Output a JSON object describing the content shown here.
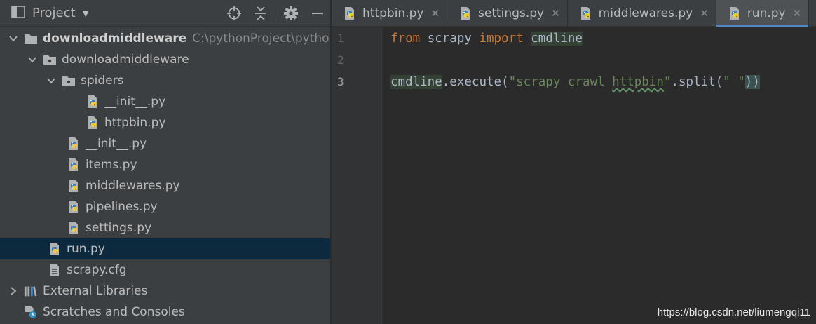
{
  "project_panel": {
    "title": "Project",
    "tools": [
      "target-icon",
      "collapse-icon",
      "gear-icon",
      "minimize-icon"
    ]
  },
  "tree": [
    {
      "label": "downloadmiddleware",
      "path": "C:\\pythonProject\\pytho",
      "icon": "folder-icon",
      "bold": true,
      "expanded": true,
      "depth": 0
    },
    {
      "label": "downloadmiddleware",
      "icon": "package-icon",
      "expanded": true,
      "depth": 1
    },
    {
      "label": "spiders",
      "icon": "package-icon",
      "expanded": true,
      "depth": 2
    },
    {
      "label": "__init__.py",
      "icon": "python-file-icon",
      "depth": 3
    },
    {
      "label": "httpbin.py",
      "icon": "python-file-icon",
      "depth": 3
    },
    {
      "label": "__init__.py",
      "icon": "python-file-icon",
      "depth": 2
    },
    {
      "label": "items.py",
      "icon": "python-file-icon",
      "depth": 2
    },
    {
      "label": "middlewares.py",
      "icon": "python-file-icon",
      "depth": 2
    },
    {
      "label": "pipelines.py",
      "icon": "python-file-icon",
      "depth": 2
    },
    {
      "label": "settings.py",
      "icon": "python-file-icon",
      "depth": 2
    },
    {
      "label": "run.py",
      "icon": "python-file-icon",
      "depth": 1,
      "selected": true
    },
    {
      "label": "scrapy.cfg",
      "icon": "text-file-icon",
      "depth": 1
    },
    {
      "label": "External Libraries",
      "icon": "library-icon",
      "expanded": false,
      "depth": 0
    },
    {
      "label": "Scratches and Consoles",
      "icon": "scratches-icon",
      "depth": 0
    }
  ],
  "tabs": [
    {
      "label": "httpbin.py",
      "active": false
    },
    {
      "label": "settings.py",
      "active": false
    },
    {
      "label": "middlewares.py",
      "active": false
    },
    {
      "label": "run.py",
      "active": true
    }
  ],
  "editor": {
    "line_numbers": [
      "1",
      "2",
      "3"
    ],
    "current_line": "3",
    "line1": {
      "kw1": "from",
      "mod": " scrapy ",
      "kw2": "import",
      "sp": " ",
      "name": "cmdline"
    },
    "line3": {
      "name": "cmdline",
      "call": ".execute(",
      "str_a": "\"scrapy crawl ",
      "str_b": "httpbin",
      "str_c": "\"",
      "split": ".split(",
      "str_sp": "\" \"",
      "close_a": ")",
      "close_b": ")"
    }
  },
  "watermark": "https://blog.csdn.net/liumengqi11",
  "colors": {
    "accent": "#4a88c7",
    "selected_row": "#0d293e",
    "keyword": "#cc7832",
    "string": "#6a8759"
  }
}
